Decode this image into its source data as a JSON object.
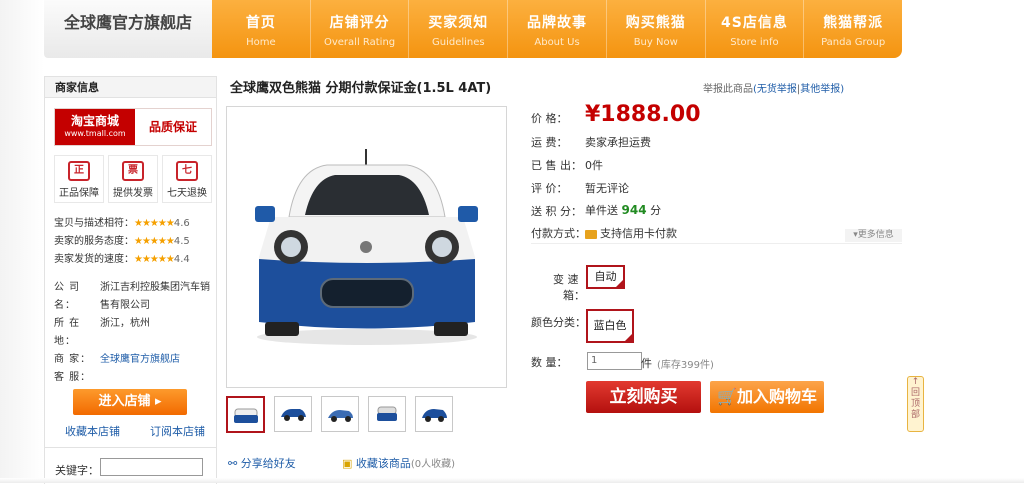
{
  "store": {
    "name": "全球鹰官方旗舰店"
  },
  "nav": [
    {
      "cn": "首页",
      "en": "Home"
    },
    {
      "cn": "店铺评分",
      "en": "Overall Rating"
    },
    {
      "cn": "买家须知",
      "en": "Guidelines"
    },
    {
      "cn": "品牌故事",
      "en": "About Us"
    },
    {
      "cn": "购买熊猫",
      "en": "Buy Now"
    },
    {
      "cn": "4S店信息",
      "en": "Store info"
    },
    {
      "cn": "熊猫帮派",
      "en": "Panda Group"
    }
  ],
  "sidebar": {
    "title": "商家信息",
    "tmall": {
      "brand": "淘宝商城",
      "url": "www.tmall.com",
      "quality": "品质保证"
    },
    "guarantees": [
      {
        "icon": "正",
        "label": "正品保障"
      },
      {
        "icon": "票",
        "label": "提供发票"
      },
      {
        "icon": "七",
        "label": "七天退换"
      }
    ],
    "ratings": [
      {
        "label": "宝贝与描述相符：",
        "value": "4.6"
      },
      {
        "label": "卖家的服务态度：",
        "value": "4.5"
      },
      {
        "label": "卖家发货的速度：",
        "value": "4.4"
      }
    ],
    "company_key": "公 司 名：",
    "company_val": "浙江吉利控股集团汽车销售有限公司",
    "location_key": "所 在 地：",
    "location_val": "浙江，杭州",
    "merchant_key": "商  家：",
    "merchant_val": "全球鹰官方旗舰店",
    "service_key": "客  服：",
    "enter_btn": "进入店铺",
    "fav_store": "收藏本店铺",
    "subscribe": "订阅本店铺",
    "keyword_label": "关键字："
  },
  "product": {
    "title": "全球鹰双色熊猫 分期付款保证金(1.5L 4AT)",
    "report_prefix": "举报此商品",
    "report_link1": "(无货举报",
    "report_sep": "|",
    "report_link2": "其他举报)",
    "price_label": "价    格：",
    "price": "¥1888.00",
    "shipping_label": "运    费：",
    "shipping_val": "卖家承担运费",
    "sold_label": "已 售 出：",
    "sold_val": "0件",
    "review_label": "评    价：",
    "review_val": "暂无评论",
    "points_label": "送 积 分：",
    "points_prefix": "单件送",
    "points_val": "944",
    "points_unit": "分",
    "payment_label": "付款方式：",
    "payment_val": "支持信用卡付款",
    "more_info": "更多信息",
    "trans_label_a": "变    速",
    "trans_label_b": "箱：",
    "trans_val": "自动",
    "color_label": "颜色分类：",
    "color_val": "蓝白色",
    "qty_label": "数    量：",
    "qty_val": "1",
    "qty_unit": "件",
    "stock": "(库存399件)",
    "buy_btn": "立刻购买",
    "cart_btn": "加入购物车",
    "share": "分享给好友",
    "fav_item": "收藏该商品",
    "fav_count": "(0人收藏)"
  },
  "back_to_top": "回顶部",
  "colors": {
    "accent": "#f49410",
    "price": "#c40000",
    "link": "#1f5da8",
    "car_blue": "#1d4f9c"
  }
}
